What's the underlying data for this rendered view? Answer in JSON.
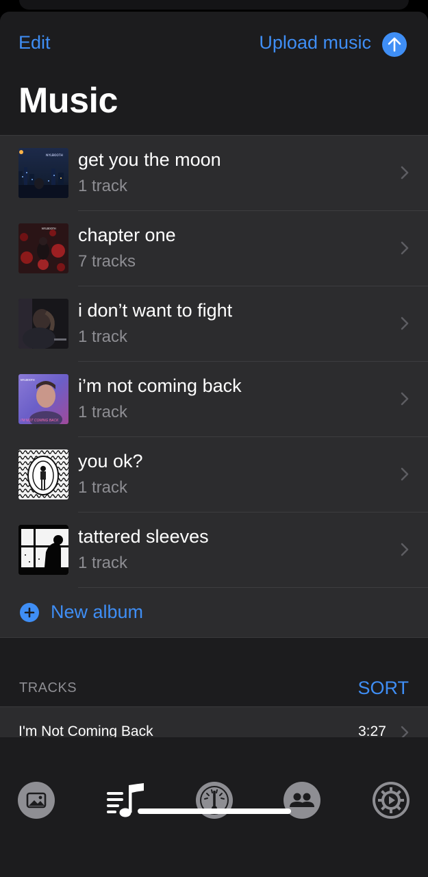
{
  "header": {
    "edit_label": "Edit",
    "upload_label": "Upload music",
    "title": "Music"
  },
  "albums": [
    {
      "title": "get you the moon",
      "subtitle": "1 track",
      "art": "night-city"
    },
    {
      "title": "chapter one",
      "subtitle": "7 tracks",
      "art": "red-roses"
    },
    {
      "title": "i don’t want to fight",
      "subtitle": "1 track",
      "art": "dark-portrait"
    },
    {
      "title": "i’m not coming back",
      "subtitle": "1 track",
      "art": "purple-portrait"
    },
    {
      "title": "you ok?",
      "subtitle": "1 track",
      "art": "bw-pattern"
    },
    {
      "title": "tattered sleeves",
      "subtitle": "1 track",
      "art": "window-silhouette"
    }
  ],
  "new_album_label": "New album",
  "tracks_section": {
    "header": "TRACKS",
    "sort_label": "SORT",
    "rows": [
      {
        "title": "I'm Not Coming Back",
        "duration": "3:27"
      }
    ]
  },
  "tabbar": {
    "tabs": [
      {
        "name": "photos",
        "icon": "photo-icon",
        "active": false
      },
      {
        "name": "music",
        "icon": "music-list-icon",
        "active": true
      },
      {
        "name": "gauge",
        "icon": "gauge-icon",
        "active": false
      },
      {
        "name": "people",
        "icon": "people-icon",
        "active": false
      },
      {
        "name": "settings",
        "icon": "gear-play-icon",
        "active": false
      }
    ]
  },
  "colors": {
    "accent": "#3f8ef5",
    "background": "#1c1c1e",
    "row_background": "#2c2c2e",
    "secondary_text": "#8e8e93"
  }
}
